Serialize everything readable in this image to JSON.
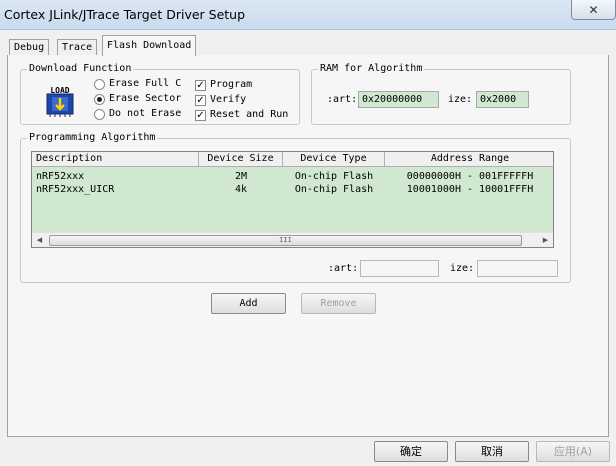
{
  "window": {
    "title": "Cortex JLink/JTrace Target Driver Setup",
    "close_glyph": "✕"
  },
  "tabs": [
    {
      "label": "Debug",
      "active": false
    },
    {
      "label": "Trace",
      "active": false
    },
    {
      "label": "Flash Download",
      "active": true
    }
  ],
  "download_function": {
    "legend": "Download Function",
    "icon": "load-chip-icon",
    "icon_text": "LOAD",
    "erase_options": [
      {
        "label": "Erase Full C",
        "selected": false
      },
      {
        "label": "Erase Sector",
        "selected": true
      },
      {
        "label": "Do not Erase",
        "selected": false
      }
    ],
    "checkboxes": [
      {
        "label": "Program",
        "checked": true
      },
      {
        "label": "Verify",
        "checked": true
      },
      {
        "label": "Reset and Run",
        "checked": true
      }
    ]
  },
  "ram_for_algorithm": {
    "legend": "RAM for Algorithm",
    "start_label": ":art:",
    "start_value": "0x20000000",
    "size_label": "ize:",
    "size_value": "0x2000"
  },
  "programming_algorithm": {
    "legend": "Programming Algorithm",
    "columns": [
      "Description",
      "Device Size",
      "Device Type",
      "Address Range"
    ],
    "rows": [
      [
        "nRF52xxx",
        "2M",
        "On-chip Flash",
        "00000000H - 001FFFFFH"
      ],
      [
        "nRF52xxx_UICR",
        "4k",
        "On-chip Flash",
        "10001000H - 10001FFFH"
      ]
    ],
    "scroll_thumb_grip": "III",
    "start_label": ":art:",
    "start_value": "",
    "size_label": "ize:",
    "size_value": "",
    "add_label": "Add",
    "remove_label": "Remove"
  },
  "footer": {
    "ok_label": "确定",
    "cancel_label": "取消",
    "apply_label": "应用(A)"
  },
  "colors": {
    "list_background": "#cfe8cf",
    "title_bar": "#c9dbee"
  }
}
